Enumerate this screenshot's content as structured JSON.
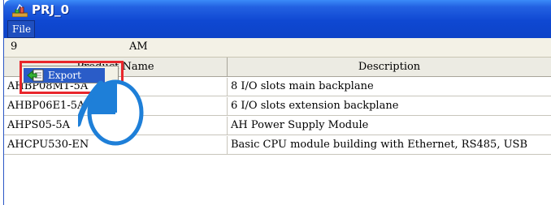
{
  "window": {
    "title": "PRJ_0",
    "app_icon": "network-tree-icon"
  },
  "menu": {
    "file_label": "File"
  },
  "toolbar": {
    "left_text": "9",
    "right_text": "AM"
  },
  "popup": {
    "export_label": "Export",
    "export_icon": "export-arrow-icon"
  },
  "table": {
    "columns": [
      "Product Name",
      "Description"
    ],
    "rows": [
      [
        "AHBP08M1-5A",
        "8 I/O slots main backplane"
      ],
      [
        "AHBP06E1-5A",
        "6 I/O slots extension backplane"
      ],
      [
        "AHPS05-5A",
        "AH Power Supply Module"
      ],
      [
        "AHCPU530-EN",
        "Basic CPU module building with Ethernet, RS485, USB"
      ]
    ]
  },
  "annotation": {
    "highlight_color": "#e8262b",
    "cursor_icon": "mouse-left-click-icon",
    "cursor_color": "#1e7fd8"
  }
}
